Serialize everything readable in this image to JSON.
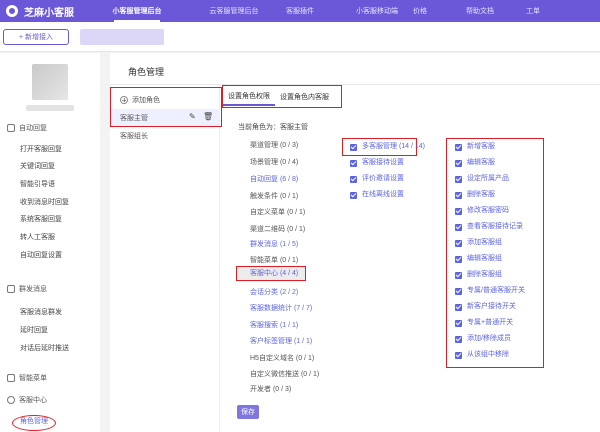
{
  "app": {
    "name": "芝麻小客服"
  },
  "topnav": [
    {
      "label": "小客服管理后台",
      "active": true
    },
    {
      "label": "云客服管理后台",
      "active": false
    },
    {
      "label": "客服插件",
      "active": false
    },
    {
      "label": "小客服移动端",
      "active": false
    },
    {
      "label": "价格",
      "active": false
    },
    {
      "label": "帮助文档",
      "active": false
    },
    {
      "label": "工单",
      "active": false
    }
  ],
  "subbar": {
    "add_label": "+ 新增接入"
  },
  "sidebar": {
    "groups": [
      {
        "label": "自动回复",
        "icon": "chat-icon",
        "items": [
          "打开客服回复",
          "关键词回复",
          "智能引导语",
          "收到消息时回复",
          "系统客服回复",
          "转人工客服",
          "自动回复设置"
        ]
      },
      {
        "label": "群发消息",
        "icon": "broadcast-icon",
        "items": [
          "客服消息群发",
          "延时回复",
          "对话后延时推送"
        ]
      },
      {
        "label": "智能菜单",
        "icon": "menu-icon",
        "items": []
      },
      {
        "label": "客服中心",
        "icon": "headset-icon",
        "items": [
          "角色管理"
        ]
      }
    ]
  },
  "main": {
    "title": "角色管理",
    "roles": {
      "add_label": "添加角色",
      "items": [
        "客服主管",
        "客服组长"
      ]
    },
    "tabs": [
      "设置角色权限",
      "设置角色内客服"
    ],
    "current_role_label": "当前角色为：客服主管",
    "modules": [
      {
        "label": "渠道管理 (0 / 3)",
        "link": false
      },
      {
        "label": "场景管理 (0 / 4)",
        "link": false
      },
      {
        "label": "自动回复 (6 / 8)",
        "link": true
      },
      {
        "label": "触发条件 (0 / 1)",
        "link": false
      },
      {
        "label": "自定义菜单 (0 / 1)",
        "link": false
      },
      {
        "label": "渠道二维码 (0 / 1)",
        "link": false
      },
      {
        "label": "群发消息 (1 / 5)",
        "link": true
      },
      {
        "label": "智能菜单 (0 / 1)",
        "link": false
      },
      {
        "label": "客服中心 (4 / 4)",
        "link": true
      },
      {
        "label": "会话分类 (2 / 2)",
        "link": true
      },
      {
        "label": "客服数据统计 (7 / 7)",
        "link": true
      },
      {
        "label": "客服搜索 (1 / 1)",
        "link": true
      },
      {
        "label": "客户标签管理 (1 / 1)",
        "link": true
      },
      {
        "label": "H5自定义域名 (0 / 1)",
        "link": false
      },
      {
        "label": "自定义微信推送 (0 / 1)",
        "link": false
      },
      {
        "label": "开发者 (0 / 3)",
        "link": false
      }
    ],
    "col2": [
      "多客服管理 (14 / 14)",
      "客服接待设置",
      "评价邀请设置",
      "在线离线设置"
    ],
    "col3": [
      "新增客服",
      "编辑客服",
      "设定所属产品",
      "删除客服",
      "修改客服密码",
      "查看客服接待记录",
      "添加客服组",
      "编辑客服组",
      "删除客服组",
      "专属/普通客服开关",
      "新客户接待开关",
      "专属+普通开关",
      "添加/移除成员",
      "从该组中移除"
    ],
    "save_label": "保存"
  },
  "colors": {
    "brand": "#6a58d9",
    "link": "#5b63e6",
    "highlight": "#e31b23"
  }
}
